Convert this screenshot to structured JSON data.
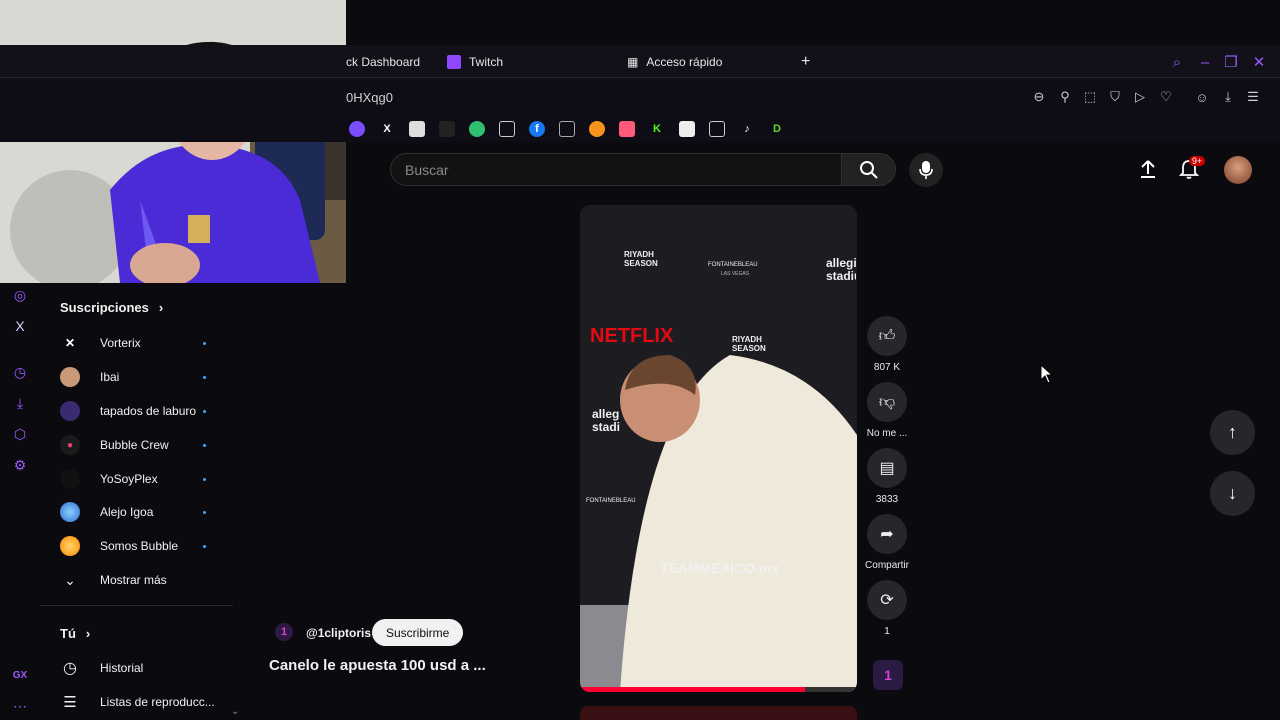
{
  "tabs": [
    {
      "label": "ck Dashboard"
    },
    {
      "label": "Twitch"
    },
    {
      "label": "Acceso rápido"
    }
  ],
  "address": {
    "text": "0HXqg0"
  },
  "search": {
    "placeholder": "Buscar"
  },
  "header": {
    "notification_badge": "9+"
  },
  "sidebar": {
    "subscriptions_title": "Suscripciones",
    "subscriptions": [
      {
        "label": "Vorterix",
        "color": "#ffffff"
      },
      {
        "label": "Ibai",
        "color": "#c99a7a"
      },
      {
        "label": "tapados de laburo",
        "color": "#5a3fa0"
      },
      {
        "label": "Bubble Crew",
        "color": "#e9417a"
      },
      {
        "label": "YoSoyPlex",
        "color": "#111111"
      },
      {
        "label": "Alejo Igoa",
        "color": "#4aa3ff"
      },
      {
        "label": "Somos Bubble",
        "color": "#ffb020"
      }
    ],
    "show_more": "Mostrar más",
    "you_title": "Tú",
    "history": "Historial",
    "playlists": "Listas de reproducc..."
  },
  "short": {
    "channel": "@1cliptoris",
    "subscribe": "Suscribirme",
    "title": "Canelo le apuesta 100 usd a ...",
    "video_text": {
      "netflix": "NETFLIX",
      "riyadh": "RIYADH SEASON",
      "fontainebleau": "FONTAINEBLEAU",
      "las_vegas": "LAS VEGAS",
      "allegiant": "allegiant stadium",
      "team_mexico": "TEAMMÉXICO.mx"
    }
  },
  "actions": {
    "likes": "807 K",
    "dislike": "No me ...",
    "comments": "3833",
    "share": "Compartir",
    "remix": "1"
  },
  "rail": {
    "gx_label": "GX"
  },
  "colors": {
    "accent": "#9b59ff",
    "youtube_red": "#ff0033"
  }
}
